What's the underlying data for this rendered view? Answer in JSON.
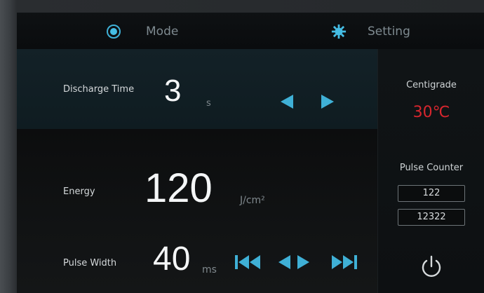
{
  "nav": {
    "mode_label": "Mode",
    "setting_label": "Setting"
  },
  "discharge": {
    "label": "Discharge Time",
    "value": "3",
    "unit": "s"
  },
  "energy": {
    "label": "Energy",
    "value": "120",
    "unit": "J/cm²"
  },
  "pulse_width": {
    "label": "Pulse Width",
    "value": "40",
    "unit": "ms"
  },
  "temperature": {
    "label": "Centigrade",
    "value": "30℃"
  },
  "pulse_counter": {
    "label": "Pulse Counter",
    "count_1": "122",
    "count_2": "12322"
  },
  "icons": {
    "mode": "radio-selected-icon",
    "setting": "gear-icon",
    "decrease": "triangle-left-icon",
    "increase": "triangle-right-icon",
    "skip_back": "skip-back-icon",
    "skip_forward": "skip-forward-icon",
    "power": "power-icon"
  },
  "colors": {
    "accent": "#3fb0d6",
    "temperature": "#d7262e",
    "text": "#f4f6f7"
  }
}
